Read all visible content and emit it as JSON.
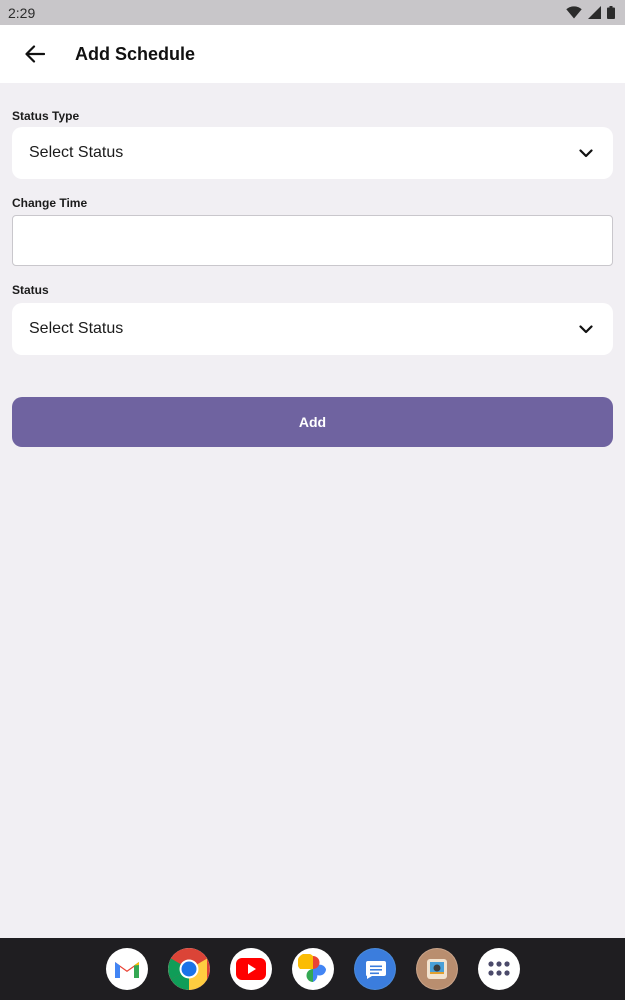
{
  "status_bar": {
    "time": "2:29",
    "icons": [
      "wifi-icon",
      "signal-icon",
      "battery-icon"
    ]
  },
  "app_bar": {
    "back_icon": "arrow-left-icon",
    "title": "Add Schedule"
  },
  "form": {
    "status_type": {
      "label": "Status Type",
      "value": "Select Status"
    },
    "change_time": {
      "label": "Change Time",
      "value": "",
      "placeholder": ""
    },
    "status": {
      "label": "Status",
      "value": "Select Status"
    },
    "submit_label": "Add"
  },
  "dock": {
    "apps": [
      "gmail-icon",
      "chrome-icon",
      "youtube-icon",
      "photos-icon",
      "messages-icon",
      "gallery-icon",
      "app-drawer-icon"
    ]
  },
  "colors": {
    "accent": "#6f63a0",
    "background": "#f1eff3",
    "surface": "#ffffff",
    "status_bar": "#c8c6c9",
    "dock": "#1f1e21"
  }
}
